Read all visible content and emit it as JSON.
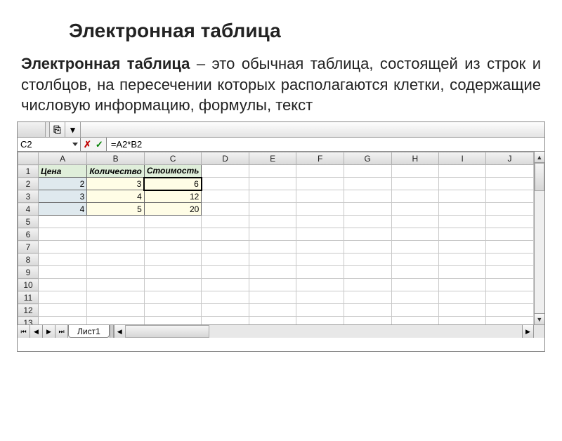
{
  "page_title": "Электронная таблица",
  "description_bold": "Электронная таблица",
  "description_rest": " – это обычная таблица, состоящей из строк и столбцов, на пересечении которых располагаются клетки, содержащие числовую информацию, формулы, текст",
  "cell_reference": "C2",
  "formula": "=A2*B2",
  "columns": [
    "A",
    "B",
    "C",
    "D",
    "E",
    "F",
    "G",
    "H",
    "I",
    "J"
  ],
  "row_numbers": [
    "1",
    "2",
    "3",
    "4",
    "5",
    "6",
    "7",
    "8",
    "9",
    "10",
    "11",
    "12",
    "13"
  ],
  "headers": {
    "a": "Цена",
    "b": "Количество",
    "c": "Стоимость"
  },
  "data": {
    "r2": {
      "a": "2",
      "b": "3",
      "c": "6"
    },
    "r3": {
      "a": "3",
      "b": "4",
      "c": "12"
    },
    "r4": {
      "a": "4",
      "b": "5",
      "c": "20"
    }
  },
  "sheet_tab": "Лист1",
  "selected_cell": "C2",
  "icons": {
    "cancel": "✗",
    "enter": "✓"
  }
}
